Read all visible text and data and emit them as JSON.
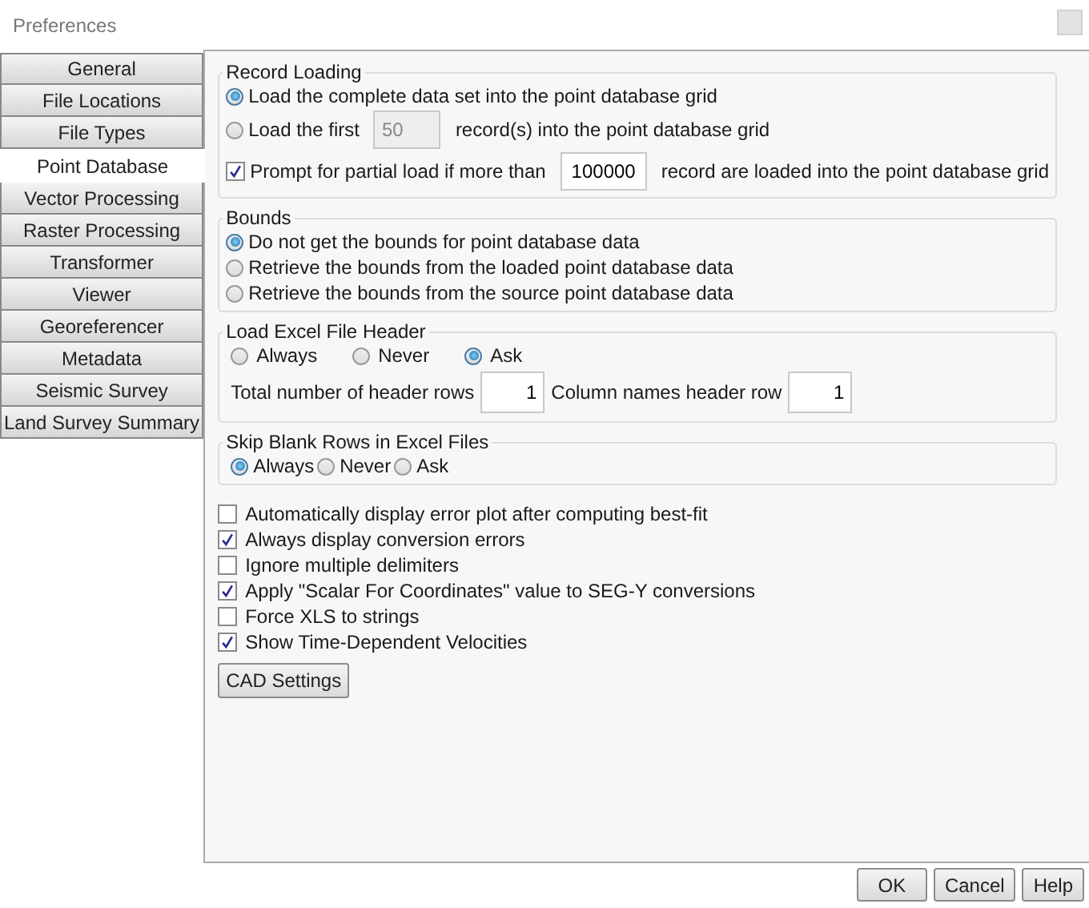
{
  "window": {
    "title": "Preferences"
  },
  "tabs": [
    {
      "label": "General",
      "selected": false
    },
    {
      "label": "File Locations",
      "selected": false
    },
    {
      "label": "File Types",
      "selected": false
    },
    {
      "label": "Point Database",
      "selected": true
    },
    {
      "label": "Vector Processing",
      "selected": false
    },
    {
      "label": "Raster Processing",
      "selected": false
    },
    {
      "label": "Transformer",
      "selected": false
    },
    {
      "label": "Viewer",
      "selected": false
    },
    {
      "label": "Georeferencer",
      "selected": false
    },
    {
      "label": "Metadata",
      "selected": false
    },
    {
      "label": "Seismic Survey",
      "selected": false
    },
    {
      "label": "Land Survey Summary",
      "selected": false
    }
  ],
  "record_loading": {
    "title": "Record Loading",
    "options": [
      {
        "kind": "radio",
        "label": "Load the complete data set into the point database grid",
        "selected": true
      },
      {
        "kind": "radio_field",
        "label": "Load the first",
        "value": "50",
        "suffix": "record(s) into the point database grid",
        "selected": false,
        "disabled": true
      },
      {
        "kind": "check_field",
        "label": "Prompt for partial load if more than",
        "value": "100000",
        "suffix": "record are loaded into the point database grid",
        "checked": true
      }
    ]
  },
  "bounds": {
    "title": "Bounds",
    "options": [
      {
        "label": "Do not get the bounds for point database data",
        "selected": true
      },
      {
        "label": "Retrieve the bounds from the loaded point database data",
        "selected": false
      },
      {
        "label": "Retrieve the bounds from the source point database data",
        "selected": false
      }
    ]
  },
  "excel_header": {
    "title": "Load Excel File Header",
    "options": [
      {
        "label": "Always",
        "selected": false
      },
      {
        "label": "Never",
        "selected": false
      },
      {
        "label": "Ask",
        "selected": true
      }
    ],
    "fields": [
      {
        "label": "Total number of header rows",
        "value": "1"
      },
      {
        "label": "Column names header row",
        "value": "1"
      }
    ]
  },
  "skip_blank": {
    "title": "Skip Blank Rows in Excel Files",
    "options": [
      {
        "label": "Always",
        "selected": true
      },
      {
        "label": "Never",
        "selected": false
      },
      {
        "label": "Ask",
        "selected": false
      }
    ]
  },
  "checkboxes": [
    {
      "label": "Automatically display error plot after computing best-fit",
      "checked": false
    },
    {
      "label": "Always display conversion errors",
      "checked": true
    },
    {
      "label": "Ignore multiple delimiters",
      "checked": false
    },
    {
      "label": "Apply \"Scalar For Coordinates\" value to SEG-Y conversions",
      "checked": true
    },
    {
      "label": "Force XLS to strings",
      "checked": false
    },
    {
      "label": "Show Time-Dependent Velocities",
      "checked": true
    }
  ],
  "cad_button": {
    "label": "CAD Settings"
  },
  "buttons": [
    {
      "label": "OK"
    },
    {
      "label": "Cancel"
    },
    {
      "label": "Help"
    }
  ]
}
